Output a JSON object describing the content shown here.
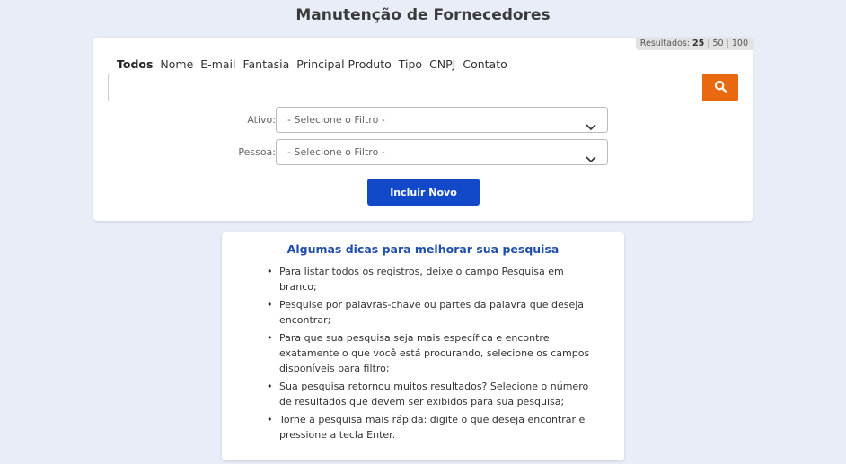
{
  "page": {
    "title": "Manutenção de Fornecedores"
  },
  "results": {
    "label": "Resultados:",
    "options": [
      "25",
      "50",
      "100"
    ],
    "selected": "25"
  },
  "filter_tabs": [
    "Todos",
    "Nome",
    "E-mail",
    "Fantasia",
    "Principal Produto",
    "Tipo",
    "CNPJ",
    "Contato"
  ],
  "filter_tabs_active": "Todos",
  "search": {
    "value": "",
    "placeholder": "",
    "button_icon": "search-icon"
  },
  "fields": {
    "ativo": {
      "label": "Ativo:",
      "selected": "- Selecione o Filtro -"
    },
    "pessoa": {
      "label": "Pessoa:",
      "selected": "- Selecione o Filtro -"
    }
  },
  "new_button": {
    "label": "Incluir Novo"
  },
  "tips": {
    "title": "Algumas dicas para melhorar sua pesquisa",
    "items": [
      "Para listar todos os registros, deixe o campo Pesquisa em branco;",
      "Pesquise por palavras-chave ou partes da palavra que deseja encontrar;",
      "Para que sua pesquisa seja mais específica e encontre exatamente o que você está procurando, selecione os campos disponíveis para filtro;",
      "Sua pesquisa retornou muitos resultados? Selecione o número de resultados que devem ser exibidos para sua pesquisa;",
      "Torne a pesquisa mais rápida: digite o que deseja encontrar e pressione a tecla Enter."
    ]
  },
  "colors": {
    "background": "#e8edf8",
    "search_button": "#e8690f",
    "primary_button": "#1149c8",
    "tips_title": "#1f4fa8"
  }
}
